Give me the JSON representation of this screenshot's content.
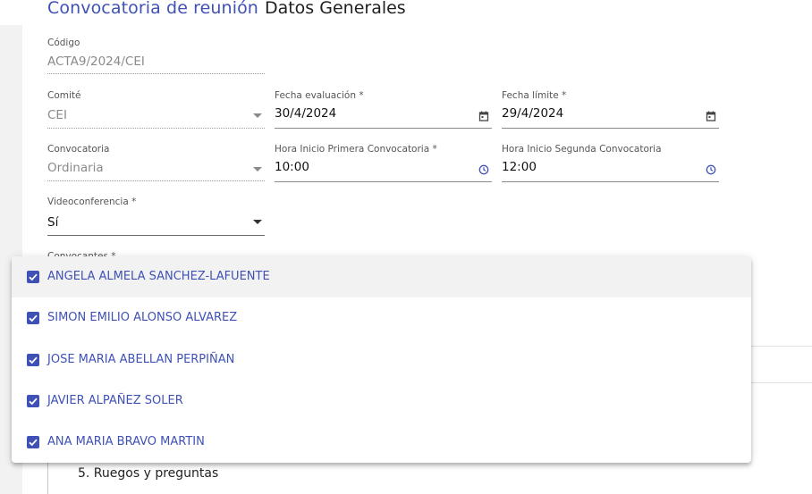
{
  "header": {
    "title": "Convocatoria de reunión",
    "subtitle": "Datos Generales"
  },
  "form": {
    "codigo": {
      "label": "Código",
      "value": "ACTA9/2024/CEI"
    },
    "comite": {
      "label": "Comité",
      "value": "CEI"
    },
    "fecha_evaluacion": {
      "label": "Fecha evaluación *",
      "value": "30/4/2024"
    },
    "fecha_limite": {
      "label": "Fecha límite *",
      "value": "29/4/2024"
    },
    "convocatoria": {
      "label": "Convocatoria",
      "value": "Ordinaria"
    },
    "hora_primera": {
      "label": "Hora Inicio Primera Convocatoria *",
      "value": "10:00"
    },
    "hora_segunda": {
      "label": "Hora Inicio Segunda Convocatoria",
      "value": "12:00"
    },
    "videoconferencia": {
      "label": "Videoconferencia *",
      "value": "Sí"
    },
    "convocantes": {
      "label": "Convocantes *"
    }
  },
  "convocantes_options": [
    {
      "label": "ANGELA ALMELA SANCHEZ-LAFUENTE",
      "checked": true
    },
    {
      "label": "SIMON EMILIO ALONSO ALVAREZ",
      "checked": true
    },
    {
      "label": "JOSE MARIA ABELLAN PERPIÑAN",
      "checked": true
    },
    {
      "label": "JAVIER ALPAÑEZ SOLER",
      "checked": true
    },
    {
      "label": "ANA MARIA BRAVO MARTIN",
      "checked": true
    }
  ],
  "orden_del_dia": {
    "item5": "5. Ruegos y preguntas"
  },
  "colors": {
    "accent": "#3f51b5",
    "text": "#222222",
    "disabled": "#8a8a8a"
  },
  "icons": {
    "date": "calendar-icon",
    "time": "clock-icon",
    "select": "dropdown-arrow-icon",
    "checkbox": "checkbox-checked-icon"
  }
}
